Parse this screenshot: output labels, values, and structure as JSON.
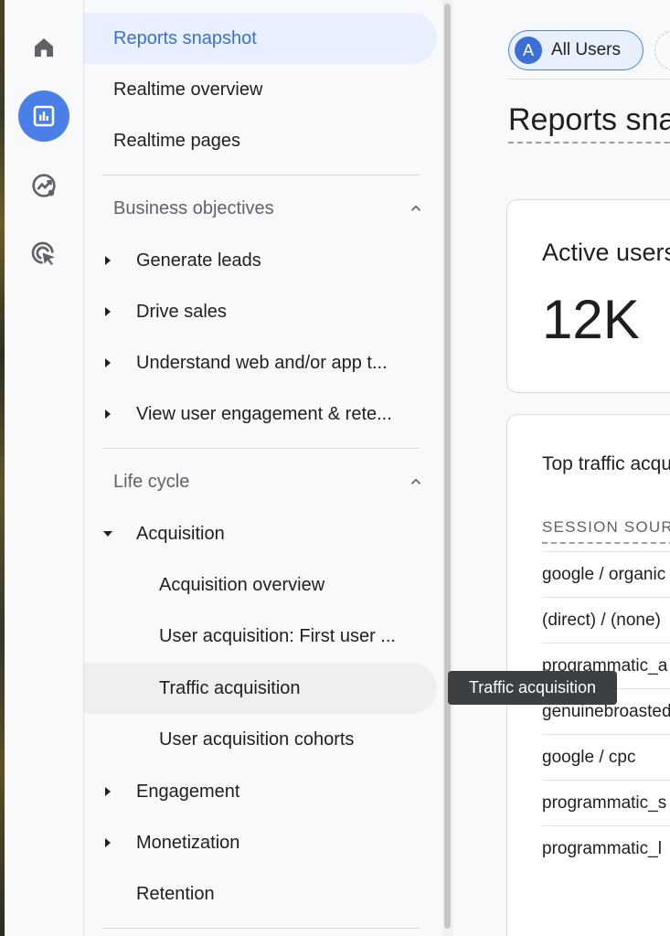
{
  "rail": {
    "items": [
      {
        "icon": "home-icon"
      },
      {
        "icon": "reports-icon",
        "active": true
      },
      {
        "icon": "explore-icon"
      },
      {
        "icon": "advertising-icon"
      }
    ]
  },
  "nav": {
    "top_items": [
      {
        "label": "Reports snapshot",
        "active": true
      },
      {
        "label": "Realtime overview"
      },
      {
        "label": "Realtime pages"
      }
    ],
    "business_objectives": {
      "title": "Business objectives",
      "items": [
        {
          "label": "Generate leads"
        },
        {
          "label": "Drive sales"
        },
        {
          "label": "Understand web and/or app t..."
        },
        {
          "label": "View user engagement & rete..."
        }
      ]
    },
    "life_cycle": {
      "title": "Life cycle",
      "acquisition": {
        "label": "Acquisition",
        "children": [
          {
            "label": "Acquisition overview"
          },
          {
            "label": "User acquisition: First user ..."
          },
          {
            "label": "Traffic acquisition",
            "hovered": true
          },
          {
            "label": "User acquisition cohorts"
          }
        ]
      },
      "items": [
        {
          "label": "Engagement"
        },
        {
          "label": "Monetization"
        },
        {
          "label": "Retention"
        }
      ]
    }
  },
  "tooltip": {
    "text": "Traffic acquisition"
  },
  "main": {
    "chip": {
      "avatar": "A",
      "label": "All Users"
    },
    "title": "Reports snapshot",
    "card1": {
      "title": "Active users",
      "value": "12K"
    },
    "card2": {
      "title": "Top traffic acquisition",
      "column_header": "SESSION SOURCE / MEDIUM",
      "rows": [
        "google / organic",
        "(direct) / (none)",
        "programmatic_a",
        "genuinebroasted",
        "google / cpc",
        "programmatic_s",
        "programmatic_l"
      ]
    }
  },
  "colors": {
    "accent": "#4b7fe8",
    "active_bg": "#e8f0fe",
    "active_text": "#3b6fd6",
    "tooltip_bg": "#3c4043"
  }
}
